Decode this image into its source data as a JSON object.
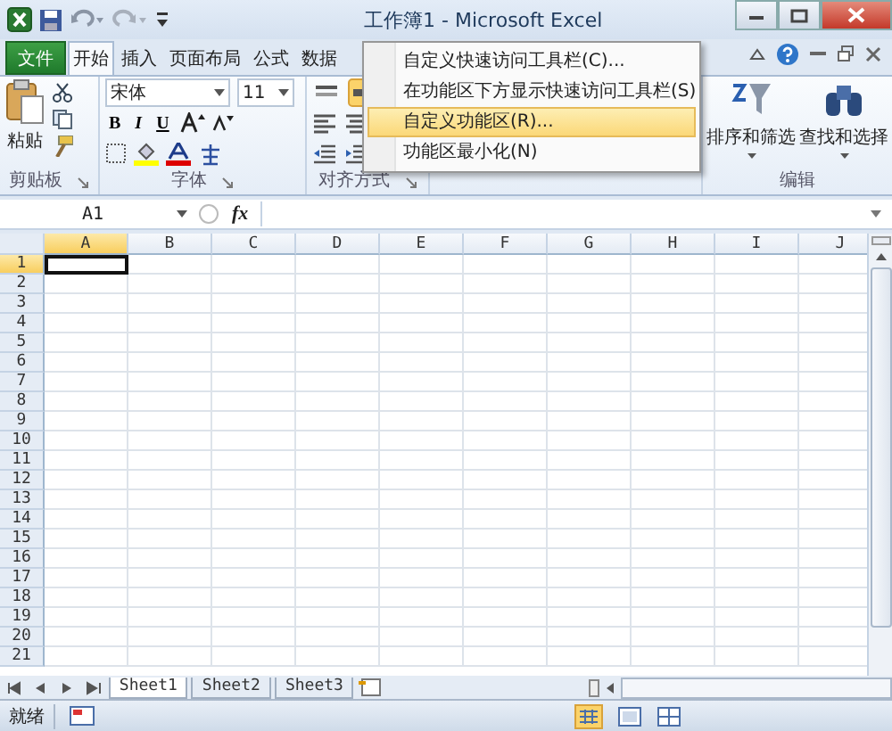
{
  "window": {
    "title": "工作簿1 - Microsoft Excel"
  },
  "tabs": [
    {
      "label": "文件",
      "kind": "file",
      "selected": false
    },
    {
      "label": "开始",
      "kind": "tab",
      "selected": true
    },
    {
      "label": "插入",
      "kind": "tab",
      "selected": false
    },
    {
      "label": "页面布局",
      "kind": "tab",
      "selected": false
    },
    {
      "label": "公式",
      "kind": "tab",
      "selected": false
    },
    {
      "label": "数据",
      "kind": "tab",
      "selected": false
    }
  ],
  "ribbon": {
    "clipboard": {
      "label": "剪贴板",
      "paste": "粘贴"
    },
    "font": {
      "label": "字体",
      "font_name": "宋体",
      "font_size": "11",
      "style_buttons": [
        "B",
        "I",
        "U"
      ]
    },
    "alignment": {
      "label": "对齐方式"
    },
    "editing": {
      "label": "编辑",
      "buttons": [
        "排序和筛选",
        "查找和选择"
      ]
    }
  },
  "context_menu": [
    {
      "label": "自定义快速访问工具栏(C)...",
      "selected": false
    },
    {
      "label": "在功能区下方显示快速访问工具栏(S)",
      "selected": false
    },
    {
      "label": "自定义功能区(R)...",
      "selected": true
    },
    {
      "label": "功能区最小化(N)",
      "selected": false
    }
  ],
  "formula_bar": {
    "name_box": "A1",
    "fx": "fx"
  },
  "grid": {
    "columns": [
      {
        "label": "A",
        "selected": true
      },
      {
        "label": "B",
        "selected": false
      },
      {
        "label": "C",
        "selected": false
      },
      {
        "label": "D",
        "selected": false
      },
      {
        "label": "E",
        "selected": false
      },
      {
        "label": "F",
        "selected": false
      },
      {
        "label": "G",
        "selected": false
      },
      {
        "label": "H",
        "selected": false
      },
      {
        "label": "I",
        "selected": false
      },
      {
        "label": "J",
        "selected": false
      }
    ],
    "rows": [
      {
        "label": "1",
        "selected": true
      },
      {
        "label": "2",
        "selected": false
      },
      {
        "label": "3",
        "selected": false
      },
      {
        "label": "4",
        "selected": false
      },
      {
        "label": "5",
        "selected": false
      },
      {
        "label": "6",
        "selected": false
      },
      {
        "label": "7",
        "selected": false
      },
      {
        "label": "8",
        "selected": false
      },
      {
        "label": "9",
        "selected": false
      },
      {
        "label": "10",
        "selected": false
      },
      {
        "label": "11",
        "selected": false
      },
      {
        "label": "12",
        "selected": false
      },
      {
        "label": "13",
        "selected": false
      },
      {
        "label": "14",
        "selected": false
      },
      {
        "label": "15",
        "selected": false
      },
      {
        "label": "16",
        "selected": false
      },
      {
        "label": "17",
        "selected": false
      },
      {
        "label": "18",
        "selected": false
      },
      {
        "label": "19",
        "selected": false
      },
      {
        "label": "20",
        "selected": false
      },
      {
        "label": "21",
        "selected": false
      }
    ]
  },
  "sheets": [
    {
      "label": "Sheet1",
      "selected": true
    },
    {
      "label": "Sheet2",
      "selected": false
    },
    {
      "label": "Sheet3",
      "selected": false
    }
  ],
  "status_bar": {
    "text": "就绪"
  }
}
